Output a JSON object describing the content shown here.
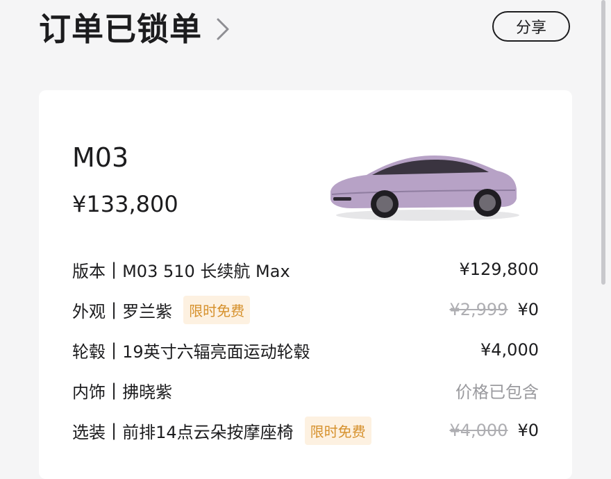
{
  "header": {
    "title": "订单已锁单",
    "share_label": "分享"
  },
  "car": {
    "model": "M03",
    "price": "¥133,800",
    "body_color": "#b7a2c6",
    "image_alt": "car-image"
  },
  "rows": [
    {
      "label": "版本",
      "value": "M03 510 长续航 Max",
      "badge": "",
      "original_price": "",
      "price": "¥129,800"
    },
    {
      "label": "外观",
      "value": "罗兰紫",
      "badge": "限时免费",
      "original_price": "¥2,999",
      "price": "¥0"
    },
    {
      "label": "轮毂",
      "value": "19英寸六辐亮面运动轮毂",
      "badge": "",
      "original_price": "",
      "price": "¥4,000"
    },
    {
      "label": "内饰",
      "value": "拂晓紫",
      "badge": "",
      "original_price": "",
      "price": "价格已包含"
    },
    {
      "label": "选装",
      "value": "前排14点云朵按摩座椅",
      "badge": "限时免费",
      "original_price": "¥4,000",
      "price": "¥0"
    }
  ],
  "separator": "|",
  "colors": {
    "background": "#f5f5f6",
    "card": "#ffffff",
    "badge_bg": "#fdf1e1",
    "badge_text": "#d6912d",
    "strike_text": "#aeaeb2"
  }
}
